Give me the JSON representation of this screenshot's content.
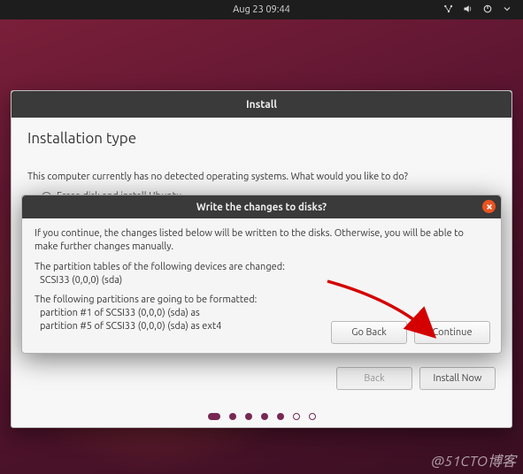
{
  "topbar": {
    "clock": "Aug 23  09:44"
  },
  "installer": {
    "titlebar": "Install",
    "heading": "Installation type",
    "prompt": "This computer currently has no detected operating systems. What would you like to do?",
    "radio_erase": "Erase disk and install Ubuntu",
    "back": "Back",
    "install_now": "Install Now"
  },
  "dialog": {
    "title": "Write the changes to disks?",
    "warning": "If you continue, the changes listed below will be written to the disks. Otherwise, you will be able to make further changes manually.",
    "pt_header": "The partition tables of the following devices are changed:",
    "pt_item1": "SCSI33 (0,0,0) (sda)",
    "fmt_header": "The following partitions are going to be formatted:",
    "fmt_item1": "partition #1 of SCSI33 (0,0,0) (sda) as",
    "fmt_item2": "partition #5 of SCSI33 (0,0,0) (sda) as ext4",
    "go_back": "Go Back",
    "continue": "Continue"
  },
  "watermark": "@51CTO博客"
}
